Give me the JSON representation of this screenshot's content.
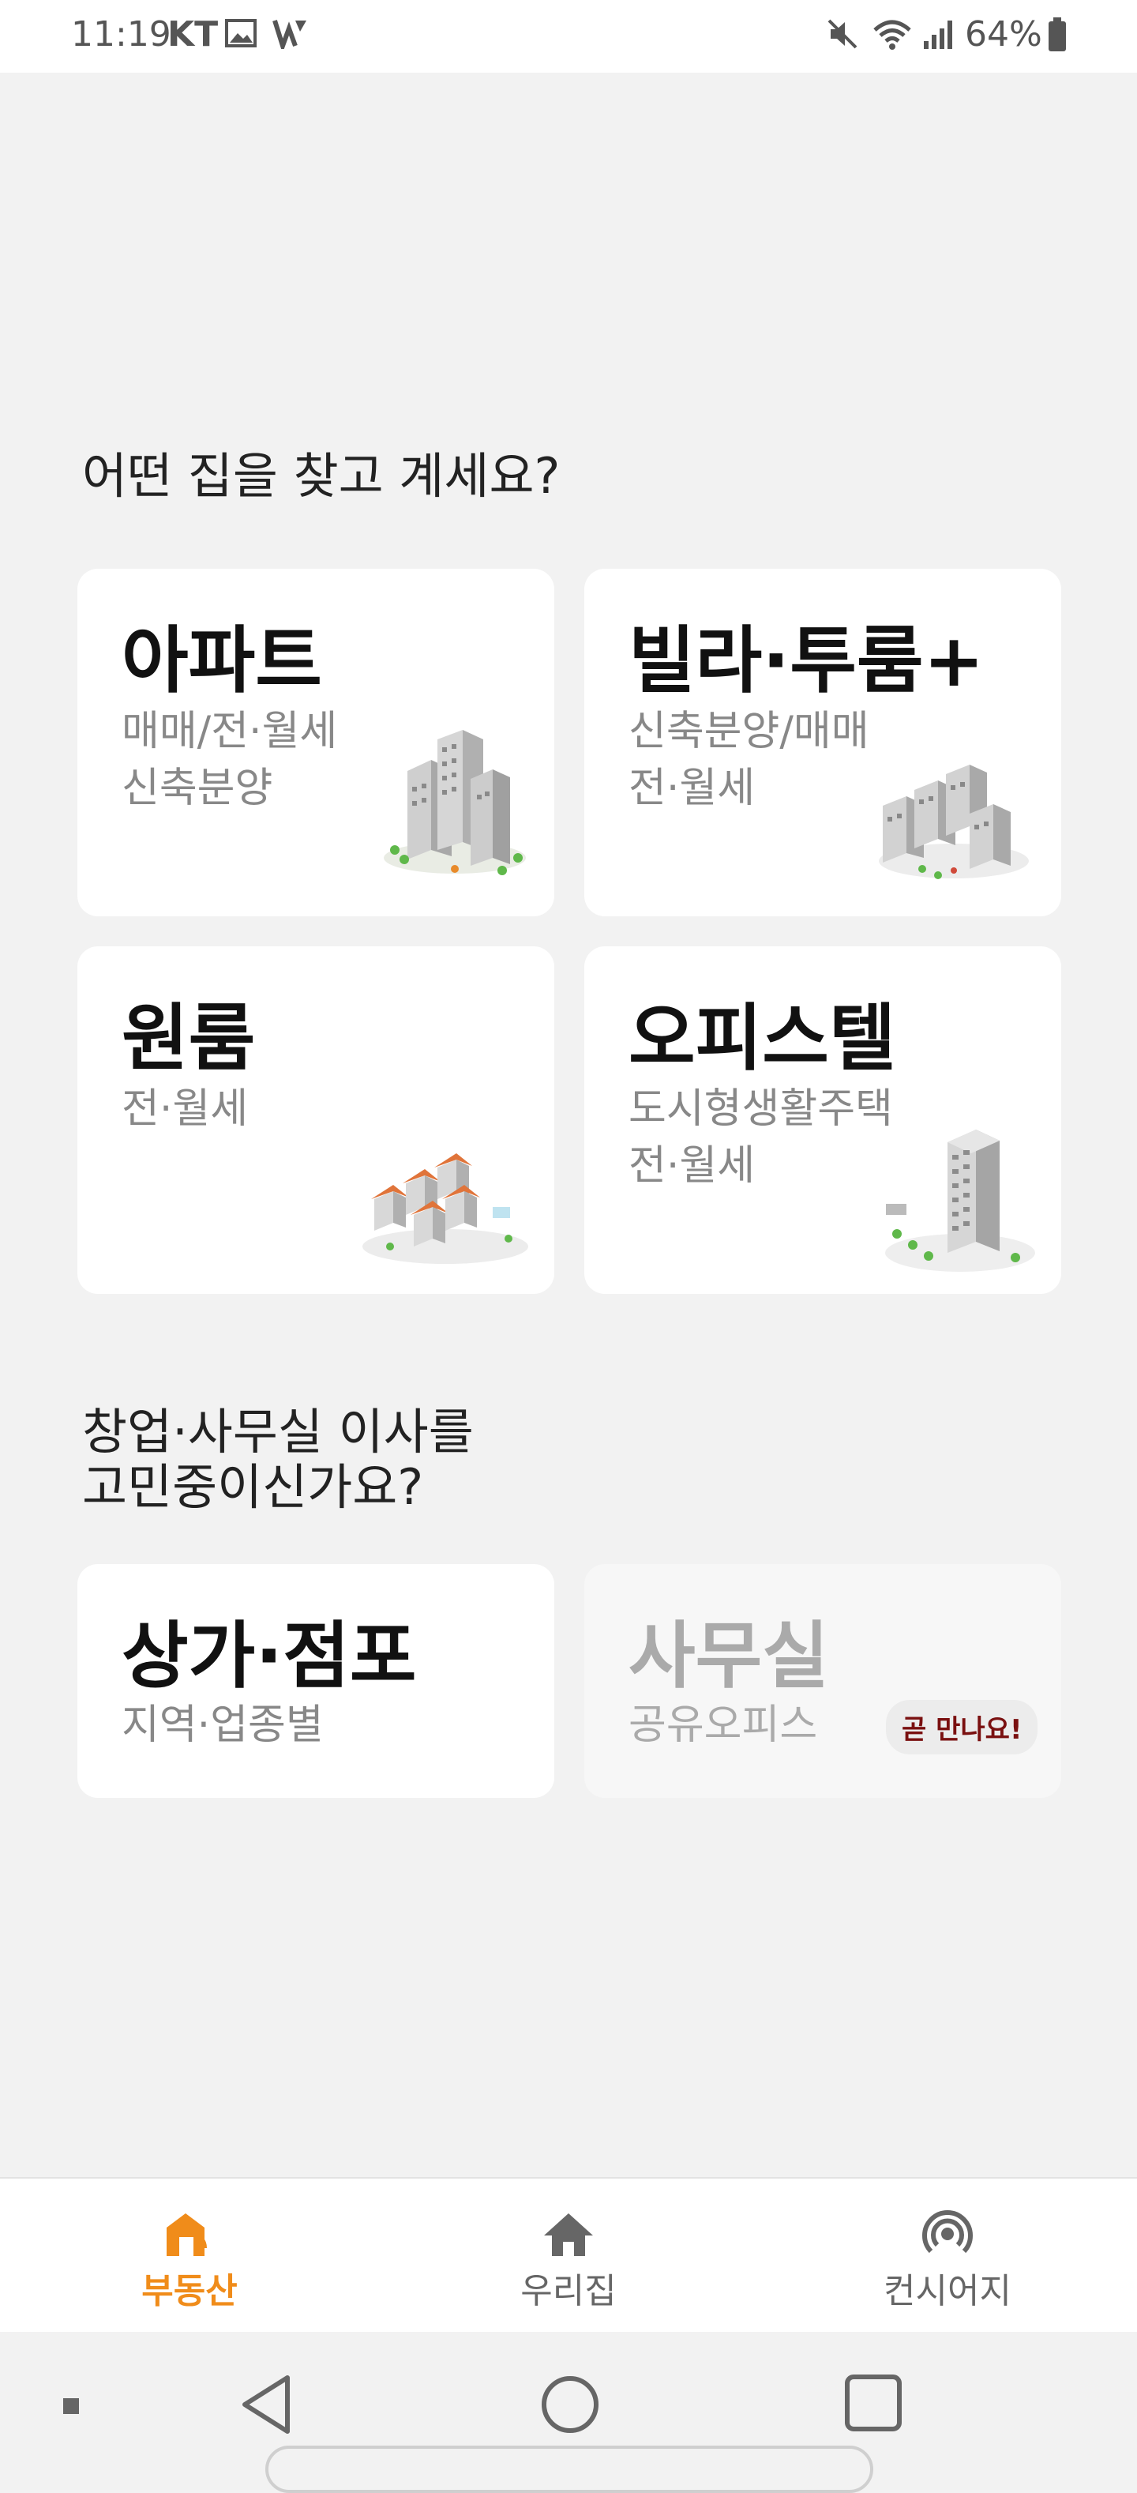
{
  "status_bar": {
    "time": "11:19",
    "carrier": "KT",
    "battery": "64%"
  },
  "sections": {
    "housing_question": "어떤 집을 찾고 계세요?",
    "business_question_line1": "창업·사무실 이사를",
    "business_question_line2": "고민중이신가요?"
  },
  "cards": {
    "apartment": {
      "title": "아파트",
      "sub1": "매매/전·월세",
      "sub2": "신축분양"
    },
    "villa": {
      "title": "빌라·투룸+",
      "sub1": "신축분양/매매",
      "sub2": "전·월세"
    },
    "oneroom": {
      "title": "원룸",
      "sub1": "전·월세"
    },
    "officetel": {
      "title": "오피스텔",
      "sub1": "도시형생활주택",
      "sub2": "전·월세"
    },
    "store": {
      "title": "상가·점포",
      "sub1": "지역·업종별"
    },
    "office": {
      "title": "사무실",
      "sub1": "공유오피스",
      "badge": "곧 만나요!"
    }
  },
  "bottom_nav": {
    "items": [
      {
        "label": "부동산",
        "icon": "real-estate-icon",
        "active": true
      },
      {
        "label": "우리집",
        "icon": "home-icon",
        "active": false
      },
      {
        "label": "컨시어지",
        "icon": "concierge-icon",
        "active": false
      }
    ]
  },
  "colors": {
    "accent": "#f08c1a",
    "background": "#f2f2f2",
    "card": "#ffffff",
    "badge_text": "#7a1010"
  }
}
